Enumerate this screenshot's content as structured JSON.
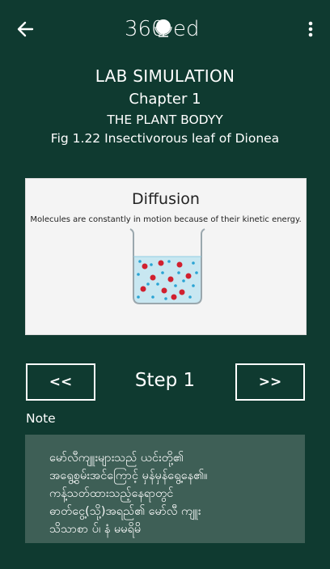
{
  "app_bar": {
    "logo_text_left": "360",
    "logo_text_right": "ed",
    "back_icon": "arrow-left-icon",
    "menu_icon": "more-vertical-icon"
  },
  "header": {
    "title": "LAB SIMULATION",
    "chapter": "Chapter 1",
    "unit": "THE PLANT BODYY",
    "figure": "Fig 1.22 Insectivorous leaf of Dionea"
  },
  "simulation": {
    "title": "Diffusion",
    "caption": "Molecules are constantly in motion because of their kinetic energy."
  },
  "navigation": {
    "prev_label": "<<",
    "step_label": "Step 1",
    "next_label": ">>"
  },
  "note": {
    "label": "Note",
    "lines": [
      "မော်လီကျူးများသည် ယင်းတို့၏",
      "အရွေ့စွမ်းအင်ကြောင့် မှန်မှန်ရွေ့နေ၏။",
      "ကန့်သတ်ထားသည့်နေရာတွင်",
      "ဓာတ်ငွေ့(သို့)အရည်၏ မော်လီ ကျူး",
      "သိသာစာ ပ်၊ နံ မမရိမိ"
    ]
  },
  "colors": {
    "background": "#0f3a30",
    "note_background": "#3e5f56",
    "molecule_red": "#d1202f",
    "molecule_blue": "#2aa4d4",
    "water": "#bfe4f0"
  }
}
